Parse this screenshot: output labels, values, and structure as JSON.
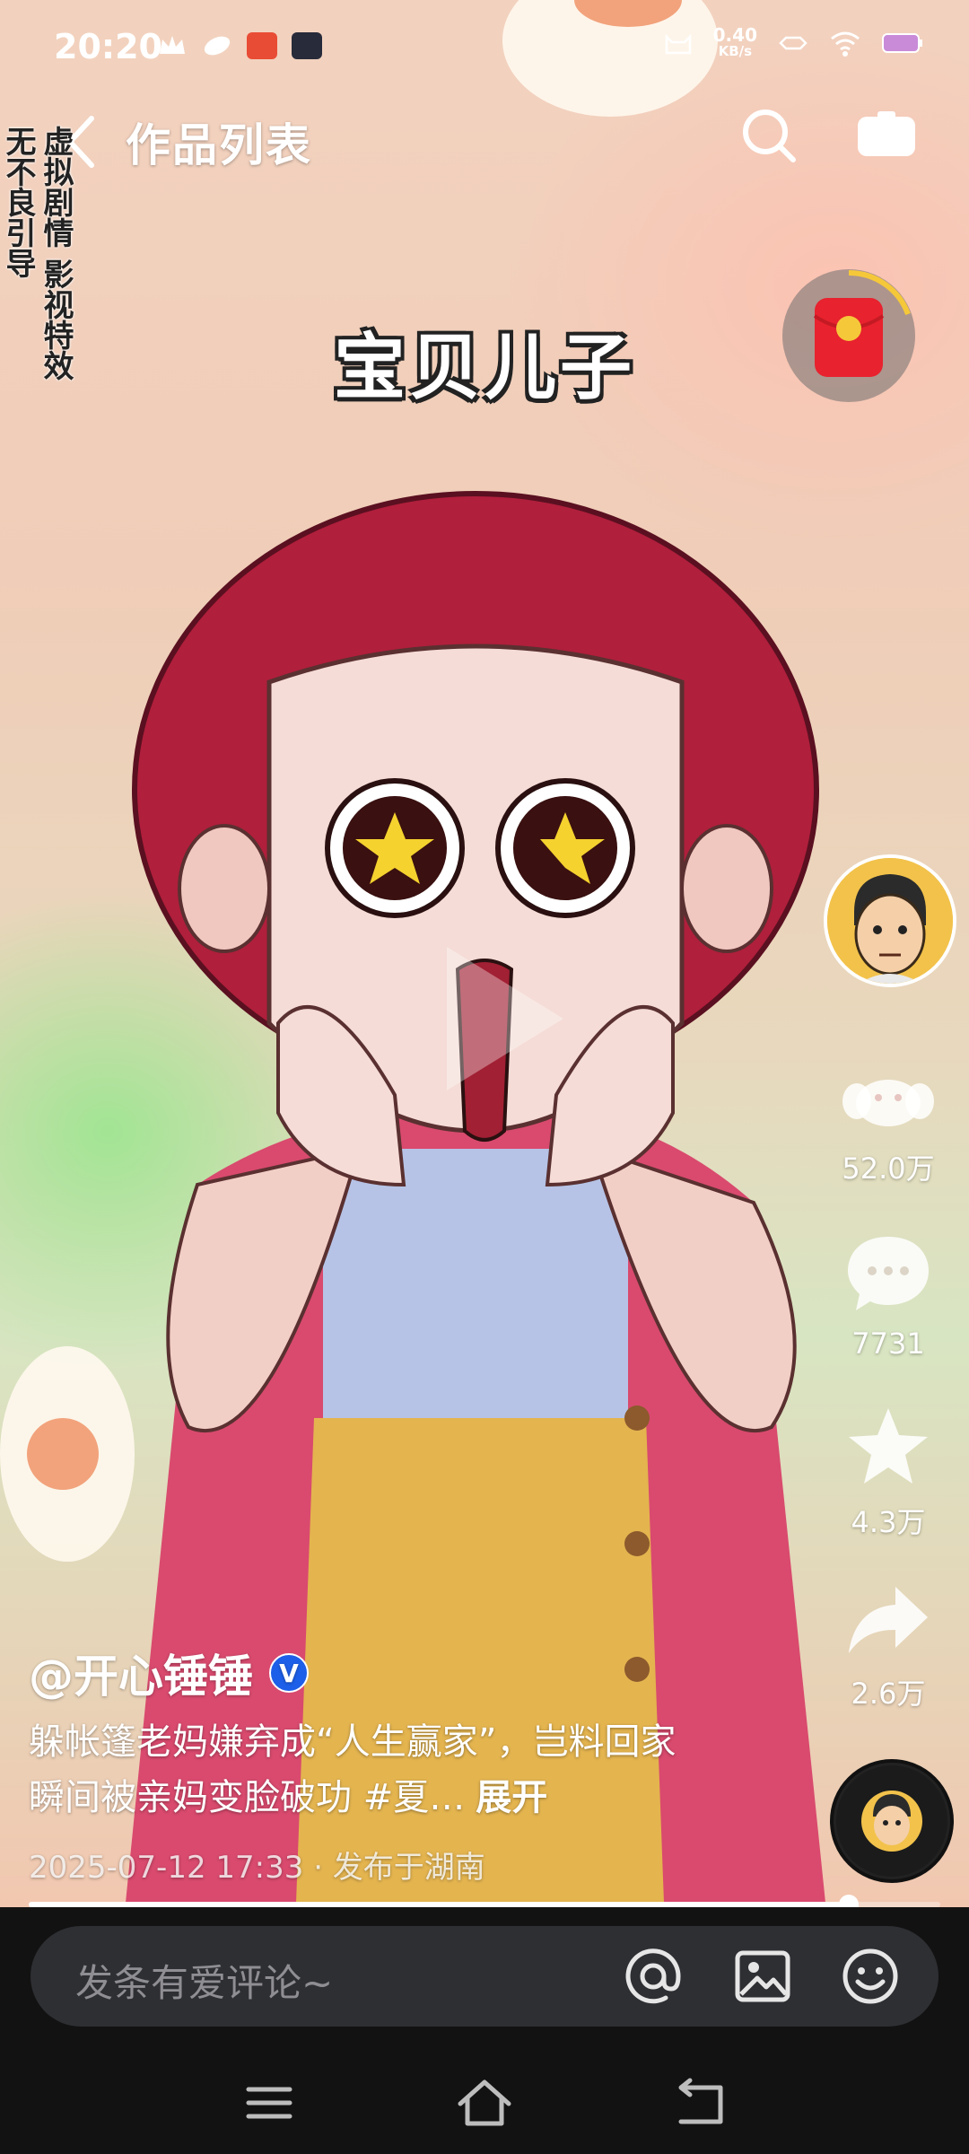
{
  "status_bar": {
    "time": "20:20",
    "net_speed_value": "0.40",
    "net_speed_unit": "KB/s"
  },
  "header": {
    "title": "作品列表"
  },
  "disclaimer": {
    "col1": "无不良引导",
    "col2": "虚拟剧情 影视特效"
  },
  "video": {
    "subtitle": "宝贝儿子",
    "progress": 0.9
  },
  "actions": {
    "likes": "52.0万",
    "comments": "7731",
    "favorites": "4.3万",
    "shares": "2.6万"
  },
  "post": {
    "author": "@开心锤锤",
    "verified_mark": "V",
    "description": "躲帐篷老妈嫌弃成“人生赢家”，岂料回家瞬间被亲妈变脸破功 #夏…",
    "expand": "展开",
    "meta": "2025-07-12 17:33 · 发布于湖南"
  },
  "comment_bar": {
    "placeholder": "发条有爱评论~"
  },
  "icons": [
    "back-icon",
    "search-icon",
    "camera-icon",
    "red-packet-icon",
    "like-icon",
    "comment-icon",
    "star-icon",
    "share-icon",
    "at-icon",
    "image-icon",
    "emoji-icon",
    "menu-icon",
    "home-icon",
    "back-nav-icon"
  ]
}
